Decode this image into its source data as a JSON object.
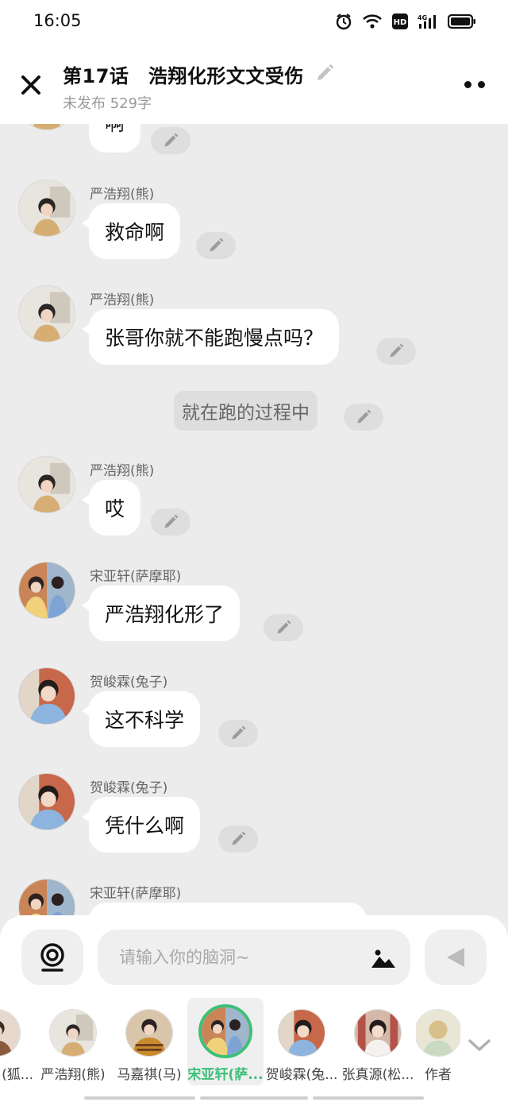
{
  "status_bar": {
    "time": "16:05"
  },
  "header": {
    "title": "第17话　浩翔化形文文受伤",
    "status": "未发布 529字"
  },
  "colors": {
    "accent": "#3dbf78",
    "background": "#ececec",
    "bubble": "#ffffff"
  },
  "messages": [
    {
      "type": "chat",
      "sender": "",
      "text": "啊",
      "avatar": "yan"
    },
    {
      "type": "chat",
      "sender": "严浩翔(熊)",
      "text": "救命啊",
      "avatar": "yan"
    },
    {
      "type": "chat",
      "sender": "严浩翔(熊)",
      "text": "张哥你就不能跑慢点吗？",
      "avatar": "yan"
    },
    {
      "type": "narration",
      "text": "就在跑的过程中"
    },
    {
      "type": "chat",
      "sender": "严浩翔(熊)",
      "text": "哎",
      "avatar": "yan"
    },
    {
      "type": "chat",
      "sender": "宋亚轩(萨摩耶)",
      "text": "严浩翔化形了",
      "avatar": "song"
    },
    {
      "type": "chat",
      "sender": "贺峻霖(兔子)",
      "text": "这不科学",
      "avatar": "he"
    },
    {
      "type": "chat",
      "sender": "贺峻霖(兔子)",
      "text": "凭什么啊",
      "avatar": "he"
    },
    {
      "type": "chat",
      "sender": "宋亚轩(萨摩耶)",
      "text": "",
      "avatar": "song"
    }
  ],
  "composer": {
    "placeholder": "请输入你的脑洞~",
    "voice_icon": "voice-icon",
    "image_icon": "image-icon",
    "send_icon": "send-icon"
  },
  "characters": [
    {
      "name": "(狐...",
      "avatar": "fox"
    },
    {
      "name": "严浩翔(熊)",
      "avatar": "yan"
    },
    {
      "name": "马嘉祺(马)",
      "avatar": "ma"
    },
    {
      "name": "宋亚轩(萨...",
      "avatar": "song",
      "selected": true
    },
    {
      "name": "贺峻霖(兔...",
      "avatar": "he"
    },
    {
      "name": "张真源(松...",
      "avatar": "zhang"
    },
    {
      "name": "作者",
      "avatar": "author"
    }
  ]
}
